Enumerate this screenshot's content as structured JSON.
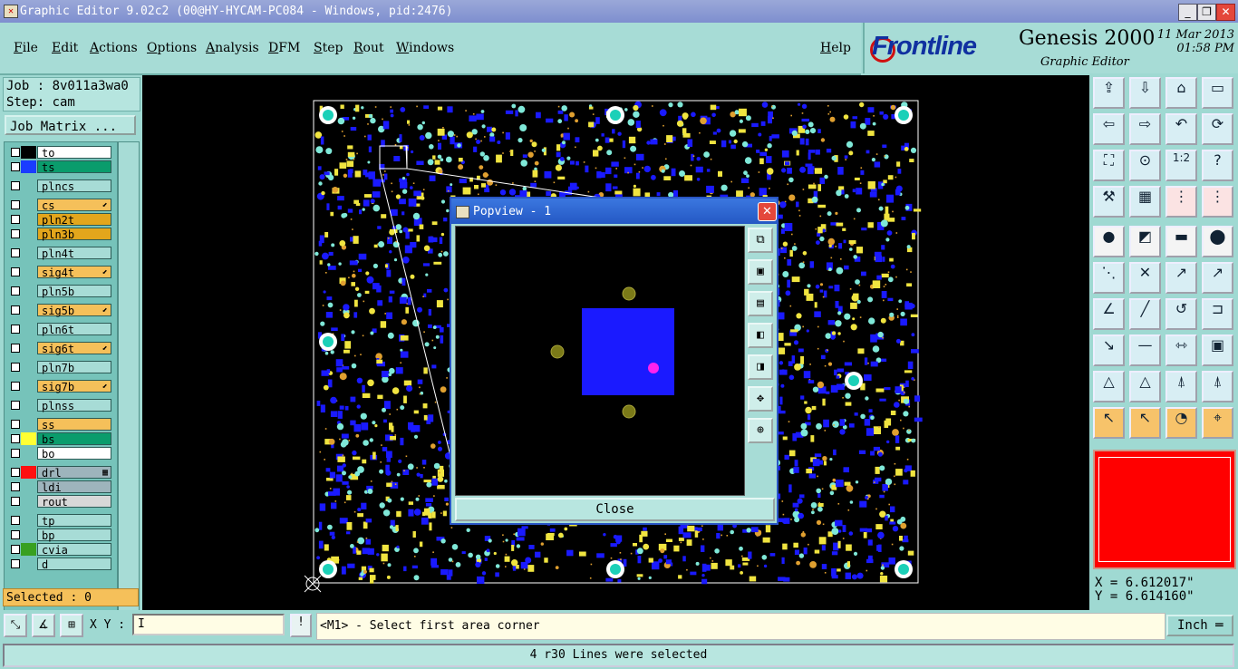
{
  "window": {
    "title": "Graphic Editor 9.02c2 (00@HY-HYCAM-PC084 - Windows, pid:2476)",
    "minimize": "_",
    "maximize": "❐",
    "close": "✕"
  },
  "menubar": {
    "items": [
      "File",
      "Edit",
      "Actions",
      "Options",
      "Analysis",
      "DFM",
      "Step",
      "Rout",
      "Windows"
    ],
    "help": "Help"
  },
  "brand": {
    "logo": "Frontline",
    "product": "Genesis 2000",
    "subtitle": "Graphic Editor",
    "date": "11 Mar 2013",
    "time": "01:58 PM"
  },
  "job": {
    "job_label": "Job : 8v011a3wa0",
    "step_label": "Step: cam",
    "matrix_button": "Job Matrix ..."
  },
  "layers": [
    {
      "name": "to",
      "color": "#ffffff",
      "swatch": "#000000"
    },
    {
      "name": "ts",
      "color": "#0a9c6c",
      "swatch": "#1a3cff"
    },
    {
      "name": "plncs",
      "color": "#a7dcd6",
      "swatch": ""
    },
    {
      "name": "cs",
      "color": "#f5c05a",
      "swatch": "",
      "mark": "⬋"
    },
    {
      "name": "pln2t",
      "color": "#e3a61c",
      "swatch": ""
    },
    {
      "name": "pln3b",
      "color": "#e3a61c",
      "swatch": ""
    },
    {
      "name": "pln4t",
      "color": "#a7dcd6",
      "swatch": ""
    },
    {
      "name": "sig4t",
      "color": "#f5c05a",
      "swatch": "",
      "mark": "⬋"
    },
    {
      "name": "pln5b",
      "color": "#a7dcd6",
      "swatch": ""
    },
    {
      "name": "sig5b",
      "color": "#f5c05a",
      "swatch": "",
      "mark": "⬋"
    },
    {
      "name": "pln6t",
      "color": "#a7dcd6",
      "swatch": ""
    },
    {
      "name": "sig6t",
      "color": "#f5c05a",
      "swatch": "",
      "mark": "⬋"
    },
    {
      "name": "pln7b",
      "color": "#a7dcd6",
      "swatch": ""
    },
    {
      "name": "sig7b",
      "color": "#f5c05a",
      "swatch": "",
      "mark": "⬋"
    },
    {
      "name": "plnss",
      "color": "#a7dcd6",
      "swatch": ""
    },
    {
      "name": "ss",
      "color": "#f5c05a",
      "swatch": ""
    },
    {
      "name": "bs",
      "color": "#0a9c6c",
      "swatch": "#ffff33"
    },
    {
      "name": "bo",
      "color": "#ffffff",
      "swatch": ""
    },
    {
      "name": "drl",
      "color": "#9eb4bc",
      "swatch": "#ff1010",
      "mark": "▦"
    },
    {
      "name": "ldi",
      "color": "#9eb4bc",
      "swatch": ""
    },
    {
      "name": "rout",
      "color": "#d8d8d8",
      "swatch": ""
    },
    {
      "name": "tp",
      "color": "#a7dcd6",
      "swatch": ""
    },
    {
      "name": "bp",
      "color": "#a7dcd6",
      "swatch": ""
    },
    {
      "name": "cvia",
      "color": "#a7dcd6",
      "swatch": "#38a020"
    },
    {
      "name": "d",
      "color": "#a7dcd6",
      "swatch": ""
    }
  ],
  "selected_label": "Selected : 0",
  "popview": {
    "title": "Popview - 1",
    "close_button": "Close",
    "tools": [
      "zoom-fit-icon",
      "zoom-in-icon",
      "zoom-out-icon",
      "pan-left-icon",
      "pan-right-icon",
      "expand-icon",
      "center-icon"
    ]
  },
  "right_tools": [
    [
      "pan-up-icon",
      "pan-down-icon",
      "home-icon",
      "zoom-window-icon"
    ],
    [
      "pan-left-icon",
      "pan-right-icon",
      "undo-zoom-icon",
      "redraw-icon"
    ],
    [
      "fit-icon",
      "center-icon",
      "one-to-one-icon",
      "help-icon"
    ],
    [
      "tools-icon",
      "grid-icon",
      "connect-icon",
      "net-icon"
    ],
    [
      "snap-icon",
      "measure-area-icon",
      "ruler-icon",
      "pad-icon"
    ],
    [
      "nodes-icon",
      "cross-icon",
      "add-point-icon",
      "move-point-icon"
    ],
    [
      "slope-icon",
      "line-icon",
      "arc-icon",
      "bracket-icon"
    ],
    [
      "feature-move-icon",
      "split-icon",
      "resize-icon",
      "copy-icon"
    ],
    [
      "triangle-icon",
      "triangle-up-icon",
      "triangle-a-icon",
      "triangle-b-icon"
    ],
    [
      "select-icon",
      "select-box-icon",
      "select-circle-icon",
      "select-net-icon"
    ]
  ],
  "coords": {
    "x_label": "X = 6.612017\"",
    "y_label": "Y = 6.614160\""
  },
  "bottom": {
    "xy_label": "X Y :",
    "xy_value": "I",
    "excl": "!",
    "prompt": "<M1> - Select first area corner",
    "unit": "Inch ═"
  },
  "status": "4 r30 Lines were selected"
}
